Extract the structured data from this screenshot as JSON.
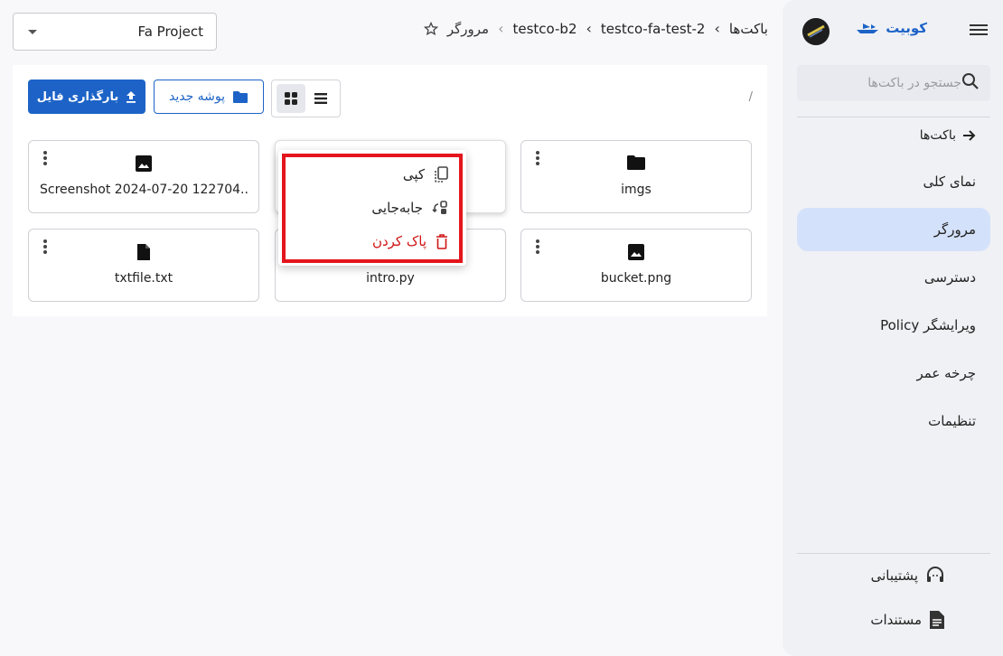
{
  "app": {
    "brand_name": "کوبیت",
    "colors": {
      "accent": "#1d63c7",
      "sidebar_bg": "#f0f1f5",
      "active_nav": "#d4e1fa",
      "danger": "#d01414",
      "highlight_border": "#e4151c"
    }
  },
  "sidebar": {
    "search_placeholder": "جستجو در باکت‌ها",
    "back_label": "باکت‌ها",
    "items": [
      {
        "label": "نمای کلی",
        "active": false
      },
      {
        "label": "مرورگر",
        "active": true
      },
      {
        "label": "دسترسی",
        "active": false
      },
      {
        "label": "ویرایشگر Policy",
        "active": false
      },
      {
        "label": "چرخه عمر",
        "active": false
      },
      {
        "label": "تنظیمات",
        "active": false
      }
    ],
    "footer": [
      {
        "label": "پشتیبانی",
        "icon": "headset-icon"
      },
      {
        "label": "مستندات",
        "icon": "document-icon"
      }
    ]
  },
  "header": {
    "project_select_value": "Fa Project",
    "breadcrumb": [
      "باکت‌ها",
      "testco-fa-test-2",
      "testco-b2",
      "مرورگر"
    ]
  },
  "toolbar": {
    "path": "/",
    "upload_label": "بارگذاری فایل",
    "new_folder_label": "پوشه جدید",
    "view_mode": "grid"
  },
  "files": [
    {
      "name": "imgs",
      "type": "folder",
      "icon": "folder-icon"
    },
    {
      "name": "",
      "type": "file",
      "icon": "file-icon"
    },
    {
      "name": "Screenshot 2024-07-20 122704....",
      "type": "image",
      "icon": "image-icon"
    },
    {
      "name": "bucket.png",
      "type": "image",
      "icon": "image-icon"
    },
    {
      "name": "intro.py",
      "type": "file",
      "icon": "file-icon"
    },
    {
      "name": "txtfile.txt",
      "type": "file",
      "icon": "file-icon"
    }
  ],
  "context_menu": {
    "items": [
      {
        "label": "کپی",
        "icon": "copy-icon"
      },
      {
        "label": "جابه‌جایی",
        "icon": "move-icon"
      },
      {
        "label": "پاک کردن",
        "icon": "trash-icon"
      }
    ]
  }
}
